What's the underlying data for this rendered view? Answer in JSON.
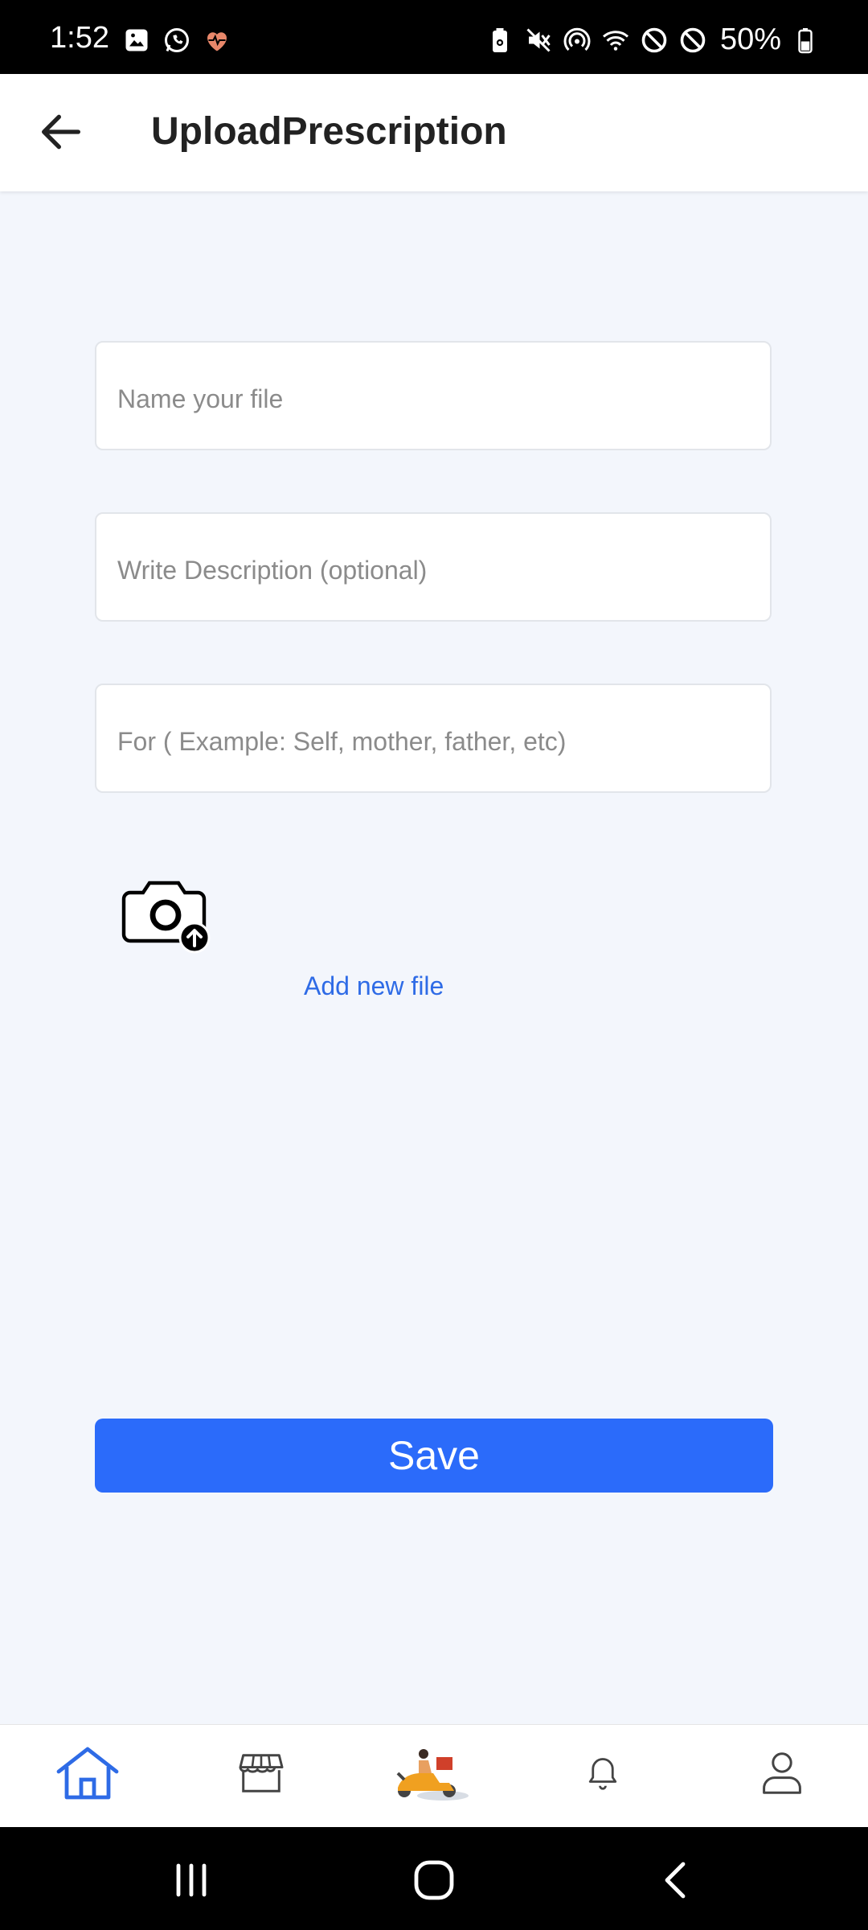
{
  "status_bar": {
    "time": "1:52",
    "battery": "50%",
    "left_icons": [
      "gallery-icon",
      "whatsapp-icon",
      "heart-rate-icon"
    ],
    "right_icons": [
      "battery-saver-icon",
      "mute-icon",
      "hotspot-icon",
      "wifi-icon",
      "block-icon",
      "block-icon",
      "battery-icon"
    ]
  },
  "app_bar": {
    "title": "UploadPrescription",
    "back_icon": "arrow-left-icon"
  },
  "form": {
    "file_name_placeholder": "Name your file",
    "description_placeholder": "Write Description (optional)",
    "for_placeholder": "For ( Example: Self, mother, father, etc)",
    "upload_icon": "camera-upload-icon",
    "add_new_file": "Add new file",
    "save": "Save"
  },
  "bottom_nav": {
    "items": [
      {
        "icon": "home-icon",
        "active": true
      },
      {
        "icon": "store-icon",
        "active": false
      },
      {
        "icon": "delivery-scooter-icon",
        "active": false
      },
      {
        "icon": "bell-icon",
        "active": false
      },
      {
        "icon": "profile-icon",
        "active": false
      }
    ]
  },
  "system_nav": [
    "recent-apps-icon",
    "home-circle-icon",
    "back-chevron-icon"
  ],
  "colors": {
    "accent": "#2b6bfa",
    "link": "#2e6be6",
    "background": "#f3f6fc",
    "home_icon": "#2e6be6",
    "scooter": "#f0a020"
  }
}
